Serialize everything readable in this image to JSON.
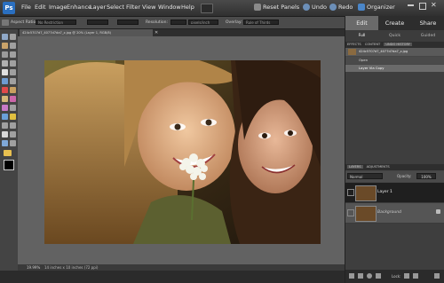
{
  "menubar": {
    "logo": "Ps",
    "items": [
      "File",
      "Edit",
      "Image",
      "Enhance",
      "Layer",
      "Select",
      "Filter",
      "View",
      "Window",
      "Help"
    ],
    "right": {
      "reset_panels": "Reset Panels",
      "undo": "Undo",
      "redo": "Redo",
      "organizer": "Organizer"
    }
  },
  "options": {
    "aspect_ratio_label": "Aspect Ratio:",
    "aspect_ratio_value": "No Restriction",
    "resolution_label": "Resolution:",
    "resolution_value": "pixels/inch",
    "overlay_label": "Overlay:",
    "overlay_value": "Rule of Thirds"
  },
  "document": {
    "tab_title": "424c5707d7_4077d7da7_z.jpg @ 20% (Layer 1, RGB/8)",
    "zoom": "19.99%",
    "info": "14 inches x 10 inches (72 ppi)"
  },
  "right_panel": {
    "tabs": {
      "edit": "Edit",
      "create": "Create",
      "share": "Share"
    },
    "subtabs": {
      "full": "Full",
      "quick": "Quick",
      "guided": "Guided"
    },
    "effects_tabs": [
      "EFFECTS",
      "CONTENT",
      "UNDO HISTORY"
    ],
    "history": [
      "424c5707d7_4077d7da7_z.jpg",
      "Open",
      "Layer Via Copy"
    ],
    "layer_tabs": [
      "LAYERS",
      "ADJUSTMENTS"
    ],
    "blend_mode": "Normal",
    "opacity_label": "Opacity:",
    "opacity_value": "100%",
    "lock_label": "Lock:",
    "layers": [
      {
        "name": "Layer 1"
      },
      {
        "name": "Background"
      }
    ]
  },
  "colors": {
    "accent": "#2a6fc0",
    "panel": "#464646",
    "canvas": "#626262"
  }
}
